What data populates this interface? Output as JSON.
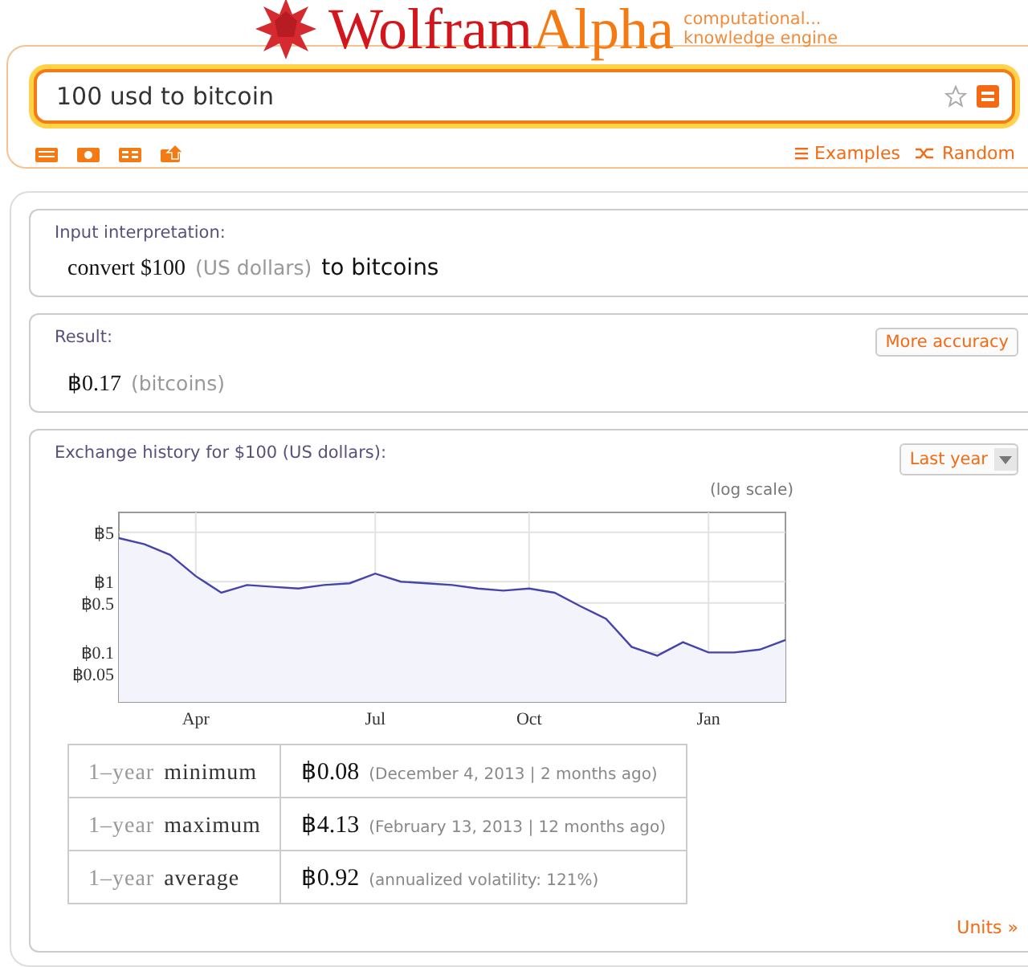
{
  "logo": {
    "word_1": "Wolfram",
    "word_2": "Alpha",
    "tagline_1": "computational...",
    "tagline_2": "knowledge engine"
  },
  "search": {
    "value": "100 usd to bitcoin"
  },
  "links": [
    {
      "label": "Examples",
      "kind": "list"
    },
    {
      "label": "Random",
      "kind": "shuffle"
    }
  ],
  "pods": [
    {
      "kind": "interpretation",
      "title": "Input interpretation:",
      "parts": [
        {
          "text": "convert $100",
          "kind": "main"
        },
        {
          "text": "(US dollars)",
          "kind": "note"
        },
        {
          "text": "to bitcoins",
          "kind": "plain"
        }
      ]
    },
    {
      "kind": "result",
      "title": "Result:",
      "button": "More accuracy",
      "parts": [
        {
          "text": "฿0.17",
          "kind": "main"
        },
        {
          "text": "(bitcoins)",
          "kind": "note"
        }
      ]
    },
    {
      "kind": "history",
      "title": "Exchange history for $100 (US dollars):",
      "dropdown": "Last year",
      "scale_note": "(log scale)",
      "chart": {
        "kind": "line",
        "x_labels": [
          "Apr",
          "Jul",
          "Oct",
          "Jan"
        ],
        "y_labels": [
          "฿5",
          "฿1",
          "฿0.5",
          "฿0.1",
          "฿0.05"
        ]
      },
      "table": [
        {
          "prefix": "1–year",
          "stat": "minimum",
          "value": "฿0.08",
          "note": "(December 4, 2013 | 2 months ago)"
        },
        {
          "prefix": "1–year",
          "stat": "maximum",
          "value": "฿4.13",
          "note": "(February 13, 2013 | 12 months ago)"
        },
        {
          "prefix": "1–year",
          "stat": "average",
          "value": "฿0.92",
          "note": "(annualized volatility: 121%)"
        }
      ],
      "footer_link": "Units »"
    }
  ]
}
